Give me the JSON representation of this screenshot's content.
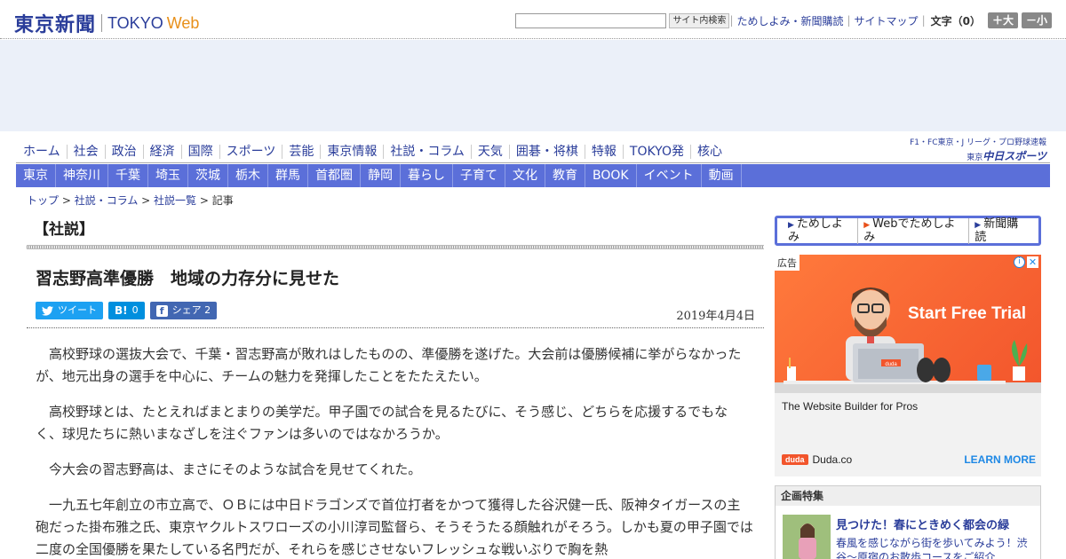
{
  "header": {
    "logo_jp": "東京新聞",
    "logo_en": "TOKYO",
    "logo_web": "Web",
    "search_button": "サイト内検索",
    "search_value": "",
    "link_trial": "ためしよみ・新聞購読",
    "link_sitemap": "サイトマップ",
    "fontsize_label": "文字（0）",
    "size_up": "＋大",
    "size_down": "－小"
  },
  "main_nav": [
    "ホーム",
    "社会",
    "政治",
    "経済",
    "国際",
    "スポーツ",
    "芸能",
    "東京情報",
    "社説・コラム",
    "天気",
    "囲碁・将棋",
    "特報",
    "TOKYO発",
    "核心"
  ],
  "chunichi": {
    "top": "F1・FC東京・J リーグ・プロ野球速報",
    "tag": "東京",
    "name": "中日スポーツ"
  },
  "sub_nav": [
    "東京",
    "神奈川",
    "千葉",
    "埼玉",
    "茨城",
    "栃木",
    "群馬",
    "首都圏",
    "静岡",
    "暮らし",
    "子育て",
    "文化",
    "教育",
    "BOOK",
    "イベント",
    "動画"
  ],
  "breadcrumb": {
    "top": "トップ",
    "column": "社説・コラム",
    "list": "社説一覧",
    "current": "記事",
    "sep": " > "
  },
  "article": {
    "section": "【社説】",
    "title": "習志野高準優勝　地域の力存分に見せた",
    "date": "2019年4月4日",
    "share_tweet": "ツイート",
    "share_hatena_icon": "B!",
    "share_hatena_count": "0",
    "share_fb_icon": "f",
    "share_fb_label": "シェア",
    "share_fb_count": "2",
    "paragraphs": [
      "高校野球の選抜大会で、千葉・習志野高が敗れはしたものの、準優勝を遂げた。大会前は優勝候補に挙がらなかったが、地元出身の選手を中心に、チームの魅力を発揮したことをたたえたい。",
      "高校野球とは、たとえればまとまりの美学だ。甲子園での試合を見るたびに、そう感じ、どちらを応援するでもなく、球児たちに熱いまなざしを注ぐファンは多いのではなかろうか。",
      "今大会の習志野高は、まさにそのような試合を見せてくれた。",
      "一九五七年創立の市立高で、ＯＢには中日ドラゴンズで首位打者をかつて獲得した谷沢健一氏、阪神タイガースの主砲だった掛布雅之氏、東京ヤクルトスワローズの小川淳司監督ら、そうそうたる顔触れがそろう。しかも夏の甲子園では二度の全国優勝を果たしている名門だが、それらを感じさせないフレッシュな戦いぶりで胸を熱"
    ]
  },
  "subscribe": {
    "item1": "ためしよみ",
    "item2": "Webでためしよみ",
    "item3": "新聞購読"
  },
  "ad": {
    "label": "広告",
    "info": "i",
    "close": "✕",
    "headline": "Start Free Trial",
    "screen_brand": "duda",
    "description": "The Website Builder for Pros",
    "brand_logo": "duda",
    "brand": "Duda.co",
    "cta": "LEARN MORE",
    "colors": {
      "bg": "#f2552c",
      "cta": "#1e88e5"
    }
  },
  "feature": {
    "head": "企画特集",
    "title": "見つけた！春にときめく都会の緑",
    "text": "春風を感じながら街を歩いてみよう！渋谷～原宿のお散歩コースをご紹介"
  },
  "colors": {
    "brand": "#2a3d9a",
    "subnav": "#5b6fd9",
    "web": "#e8901a"
  }
}
